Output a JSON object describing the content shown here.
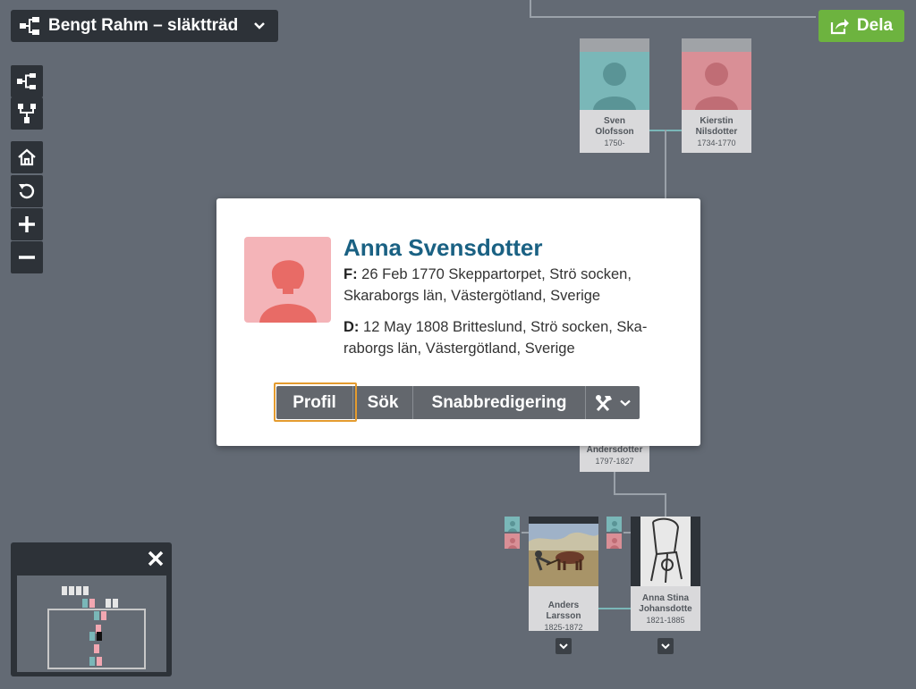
{
  "header": {
    "tree_title": "Bengt Rahm – släktträd",
    "share_label": "Dela"
  },
  "toolbar": {
    "tools": [
      "pedigree-view",
      "descendant-view",
      "home",
      "reset",
      "zoom-in",
      "zoom-out"
    ]
  },
  "tree": {
    "cards": [
      {
        "name_line1": "Sven",
        "name_line2": "Olofsson",
        "dates": "1750-",
        "gender": "male"
      },
      {
        "name_line1": "Kierstin",
        "name_line2": "Nilsdotter",
        "dates": "1734-1770",
        "gender": "female"
      },
      {
        "name_line1": "Andersdotter",
        "name_line2": "",
        "dates": "1797-1827",
        "gender": "female"
      },
      {
        "name_line1": "Anders",
        "name_line2": "Larsson",
        "dates": "1825-1872",
        "gender": "male"
      },
      {
        "name_line1": "Anna Stina",
        "name_line2": "Johansdotte",
        "dates": "1821-1885",
        "gender": "female"
      }
    ]
  },
  "popup": {
    "name": "Anna Svensdotter",
    "birth_label": "F:",
    "birth_text": "26 Feb 1770 Skeppartorpet, Strö socken,",
    "birth_text2": "Skaraborgs län, Västergötland, Sverige",
    "death_label": "D:",
    "death_text": "12 May 1808 Britteslund, Strö socken, Ska-",
    "death_text2": "raborgs län, Västergötland, Sverige",
    "buttons": {
      "profile": "Profil",
      "search": "Sök",
      "quick_edit": "Snabbredigering"
    }
  },
  "colors": {
    "background": "#636a74",
    "dark": "#2d3238",
    "share_green": "#6db33f",
    "name_blue": "#1a6183",
    "focus_orange": "#e49b2e",
    "male": "#7ab7b8",
    "female": "#d98f96"
  }
}
